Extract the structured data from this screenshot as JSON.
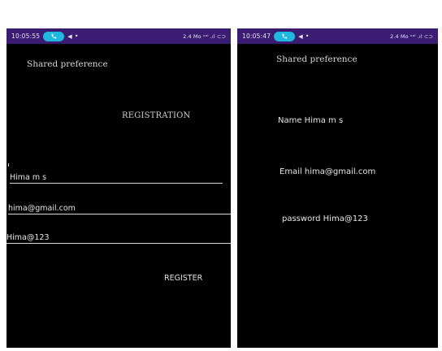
{
  "left": {
    "status": {
      "time": "10:05:55",
      "right": "2.4 Mo ᵛᵒˡ .ıl ⊂⊃"
    },
    "app_title": "Shared preference",
    "heading": "REGISTRATION",
    "fields": {
      "name": "Hima m s",
      "email": "hima@gmail.com",
      "password": "Hima@123"
    },
    "register_label": "REGISTER"
  },
  "right": {
    "status": {
      "time": "10:05:47",
      "right": "2.4 Mo ᵛᵒˡ .ıl ⊂⊃"
    },
    "app_title": "Shared preference",
    "name_line": "Name  Hima m s",
    "email_line": "Email hima@gmail.com",
    "password_line": "password Hima@123"
  },
  "colors": {
    "status_bar": "#3a1d73",
    "call_pill": "#1fb9e0",
    "background": "#000000"
  },
  "icons": [
    "phone-icon",
    "navigation-arrow-icon",
    "notification-dot-icon"
  ]
}
